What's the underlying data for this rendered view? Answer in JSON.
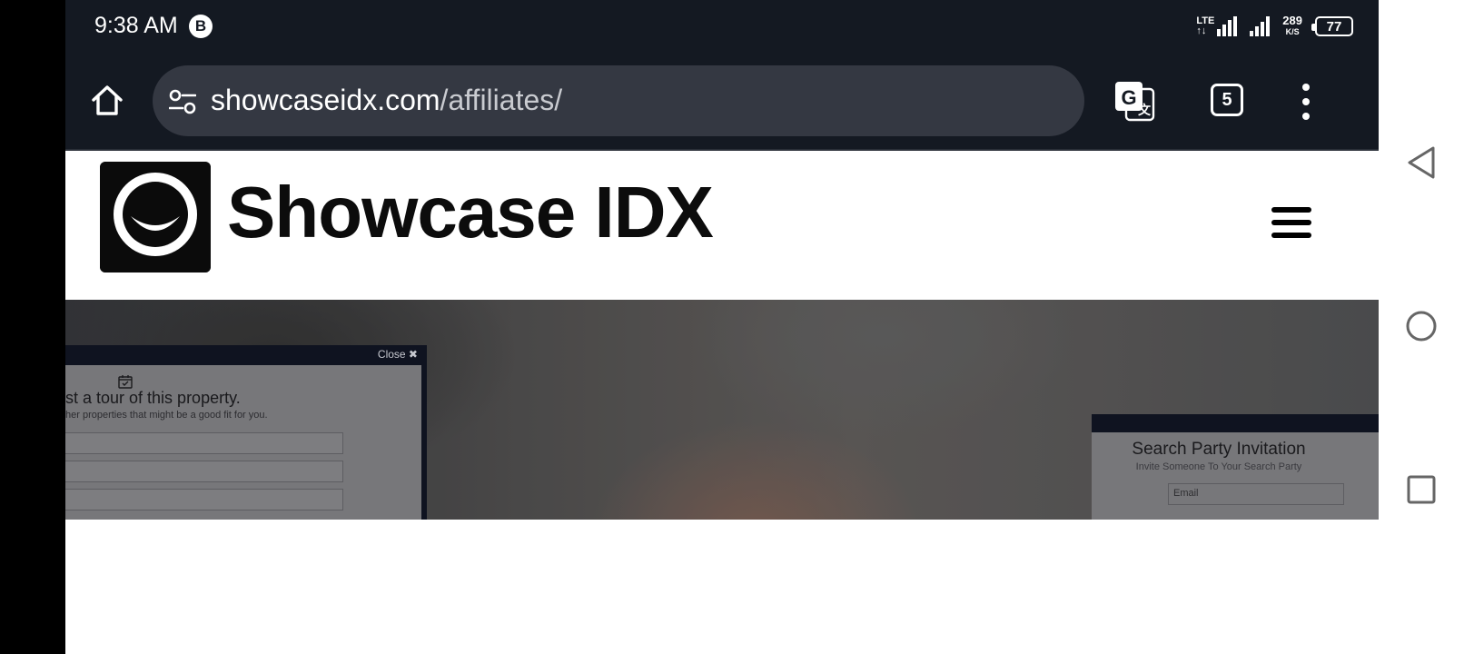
{
  "status_bar": {
    "time": "9:38 AM",
    "badge": "B",
    "network": "LTE",
    "net_speed": "289",
    "net_speed_unit": "K/S",
    "battery": "77"
  },
  "browser": {
    "url_domain": "showcaseidx.com",
    "url_path": "/affiliates/",
    "tab_count": "5"
  },
  "site": {
    "logo_text": "Showcase IDX"
  },
  "tour_modal": {
    "close_label": "Close ✖",
    "title": "st a tour of this property.",
    "subtitle": "her properties that might be a good fit for you."
  },
  "search_modal": {
    "title": "Search Party Invitation",
    "subtitle": "Invite Someone To Your Search Party",
    "email_placeholder": "Email"
  },
  "colors": {
    "status_bg": "#141922",
    "url_pill": "#343842",
    "modal_header": "#0f1320"
  },
  "icons": {
    "home": "home-icon",
    "tune": "site-settings-icon",
    "translate": "translate-icon",
    "menu": "more-vert-icon",
    "back": "back-triangle-icon",
    "home_nav": "home-circle-icon",
    "recents": "recents-square-icon"
  }
}
